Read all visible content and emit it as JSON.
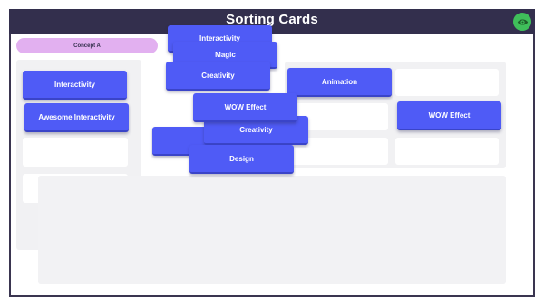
{
  "header": {
    "title": "Sorting Cards",
    "icon": "eye-icon"
  },
  "category": {
    "label": "Concept A"
  },
  "cards": [
    {
      "id": "interactivity-top",
      "label": "Interactivity"
    },
    {
      "id": "magic",
      "label": "Magic"
    },
    {
      "id": "creativity-top",
      "label": "Creativity"
    },
    {
      "id": "animation",
      "label": "Animation"
    },
    {
      "id": "interactivity-left",
      "label": "Interactivity"
    },
    {
      "id": "awesome-interactivity",
      "label": "Awesome Interactivity"
    },
    {
      "id": "wow-effect-mid",
      "label": "WOW Effect"
    },
    {
      "id": "creativity-mid",
      "label": "Creativity"
    },
    {
      "id": "design",
      "label": "Design"
    },
    {
      "id": "wow-effect-right",
      "label": "WOW Effect"
    }
  ],
  "colors": {
    "header": "#332f4d",
    "card": "#4f5bf6",
    "pill": "#e2b0f0",
    "eye": "#3fbf5a",
    "panel": "#f1f1f3"
  }
}
